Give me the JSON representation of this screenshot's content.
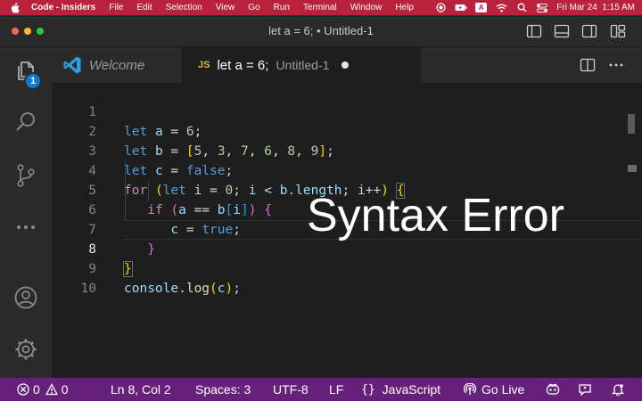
{
  "menubar": {
    "app_name": "Code - Insiders",
    "items": [
      "File",
      "Edit",
      "Selection",
      "View",
      "Go",
      "Run",
      "Terminal",
      "Window",
      "Help"
    ],
    "input_badge": "A",
    "datetime": "Fri Mar 24  1:15 AM"
  },
  "window": {
    "title": "let a = 6; • Untitled-1"
  },
  "activity": {
    "explorer_badge": "1"
  },
  "tabs": [
    {
      "label": "Welcome",
      "italic": true
    },
    {
      "type_badge": "JS",
      "label": "let a = 6;",
      "subtitle": "Untitled-1",
      "dirty": true
    }
  ],
  "editor": {
    "current_line": 8,
    "lines": [
      {
        "n": "1",
        "text": "let a = 6;"
      },
      {
        "n": "2",
        "text": "let b = [5, 3, 7, 6, 8, 9];"
      },
      {
        "n": "3",
        "text": "let c = false;"
      },
      {
        "n": "4",
        "text": "for (let i = 0; i < b.length; i++) {"
      },
      {
        "n": "5",
        "text": "if (a == b[i]) {"
      },
      {
        "n": "6",
        "text": "c = true;"
      },
      {
        "n": "7",
        "text": "}"
      },
      {
        "n": "8",
        "text": "}"
      },
      {
        "n": "9",
        "text": "console.log(c);"
      },
      {
        "n": "10",
        "text": ""
      }
    ],
    "overlay": "Syntax Error"
  },
  "statusbar": {
    "errors": "0",
    "warnings": "0",
    "position": "Ln 8, Col 2",
    "spaces": "Spaces: 3",
    "encoding": "UTF-8",
    "eol": "LF",
    "language": "JavaScript",
    "go_live": "Go Live"
  },
  "colors": {
    "menubar_bg": "#b9223a",
    "statusbar_bg": "#68217a",
    "badge_blue": "#0b7ad1"
  }
}
